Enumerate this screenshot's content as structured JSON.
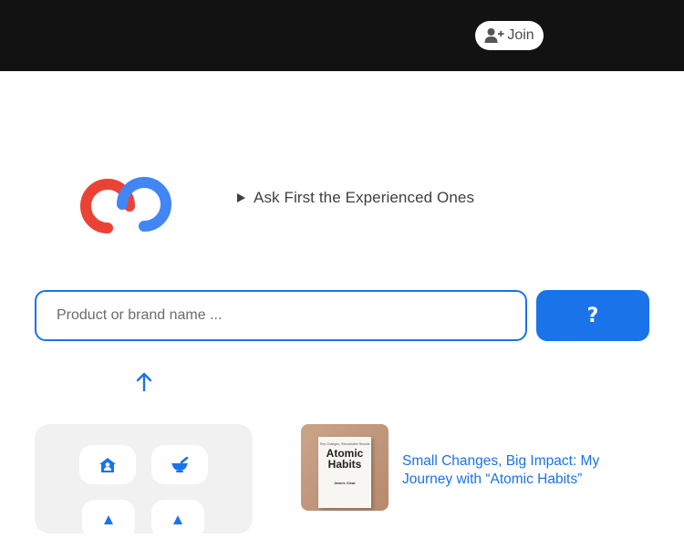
{
  "header": {
    "join_label": "Join",
    "join_icon": "user-plus-icon",
    "background": "#121212"
  },
  "hero": {
    "logo": "brand-logo-icon",
    "tagline": "Ask First the Experienced Ones"
  },
  "search": {
    "placeholder": "Product or brand name ...",
    "value": "",
    "submit_label": "?",
    "accent": "#1a73e8"
  },
  "scroll_up_icon": "arrow-up-icon",
  "categories": [
    {
      "icon": "home-person-icon"
    },
    {
      "icon": "mortar-pestle-icon"
    },
    {
      "icon": "category-icon"
    },
    {
      "icon": "category-icon"
    }
  ],
  "article": {
    "title": "Small Changes, Big Impact: My Journey with “Atomic Habits”",
    "book": {
      "tagline": "Tiny Changes, Remarkable Results",
      "title_line1": "Atomic",
      "title_line2": "Habits",
      "author": "James Clear"
    }
  },
  "colors": {
    "logo_red": "#ea4335",
    "logo_blue": "#4285f4",
    "link": "#1a73e8"
  }
}
